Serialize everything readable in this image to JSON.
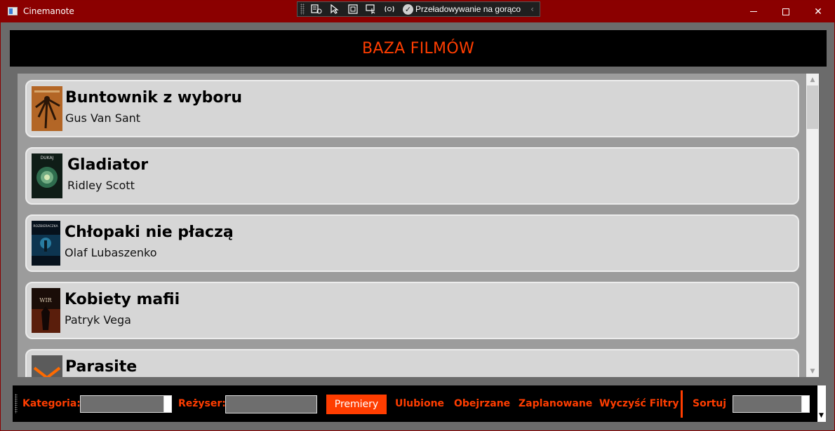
{
  "window": {
    "title": "Cinemanote",
    "minimize_icon": "minimize-icon",
    "maximize_icon": "maximize-icon",
    "close_glyph": "✕"
  },
  "devtoolbar": {
    "hot_reload_label": "Przeładowywanie na gorąco",
    "check_glyph": "✓",
    "collapse_glyph": "‹"
  },
  "header": {
    "title": "BAZA FILMÓW",
    "accent": "#ff3d00"
  },
  "movies": [
    {
      "title": "Buntownik z wyboru",
      "director": "Gus Van Sant"
    },
    {
      "title": "Gladiator",
      "director": "Ridley Scott",
      "poster_text": "DUKAJ"
    },
    {
      "title": "Chłopaki nie płaczą",
      "director": "Olaf Lubaszenko",
      "poster_text": "ROZBIERACZKA"
    },
    {
      "title": "Kobiety mafii",
      "director": "Patryk Vega",
      "poster_text": "WIR"
    },
    {
      "title": "Parasite",
      "director": ""
    }
  ],
  "filters": {
    "category_label": "Kategoria:",
    "director_label": "Reżyser:",
    "premieres_button": "Premiery",
    "favorites_button": "Ulubione",
    "watched_button": "Obejrzane",
    "planned_button": "Zaplanowane",
    "clear_button": "Wyczyść Filtry",
    "sort_label": "Sortuj"
  },
  "scrollbar": {
    "up_glyph": "▲",
    "down_glyph": "▼"
  }
}
